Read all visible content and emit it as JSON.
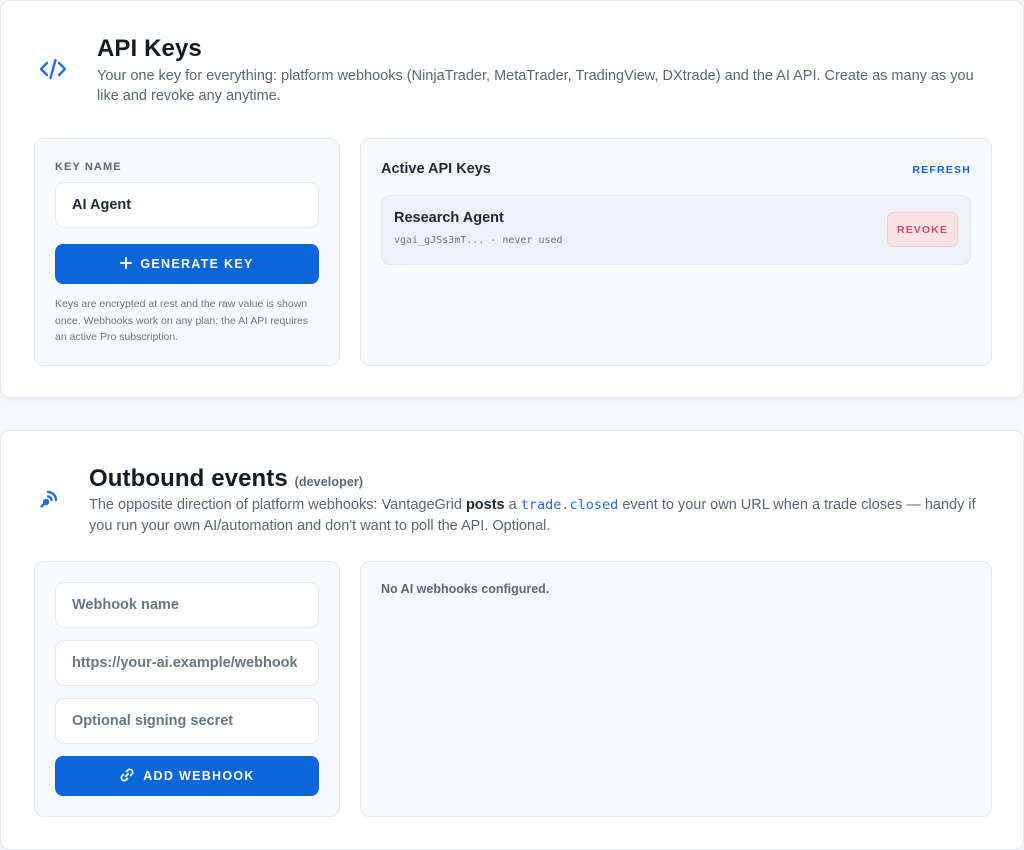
{
  "api_keys": {
    "title": "API Keys",
    "subtitle": "Your one key for everything: platform webhooks (NinjaTrader, MetaTrader, TradingView, DXtrade) and the AI API. Create as many as you like and revoke any anytime.",
    "icon": "code-icon",
    "form": {
      "key_name_label": "KEY NAME",
      "key_name_value": "AI Agent",
      "generate_label": "GENERATE KEY",
      "note": "Keys are encrypted at rest and the raw value is shown once. Webhooks work on any plan; the AI API requires an active Pro subscription."
    },
    "active": {
      "title": "Active API Keys",
      "refresh_label": "REFRESH",
      "keys": [
        {
          "name": "Research Agent",
          "meta": "vgai_gJSs3mT... - never used",
          "revoke_label": "REVOKE"
        }
      ]
    }
  },
  "outbound": {
    "title": "Outbound events",
    "title_tag": "(developer)",
    "icon": "webhook-icon",
    "subtitle_pre": "The opposite direction of platform webhooks: VantageGrid ",
    "subtitle_bold": "posts",
    "subtitle_mid": " a ",
    "subtitle_code": "trade.closed",
    "subtitle_post": " event to your own URL when a trade closes — handy if you run your own AI/automation and don't want to poll the API. Optional.",
    "form": {
      "name_placeholder": "Webhook name",
      "url_placeholder": "https://your-ai.example/webhook",
      "secret_placeholder": "Optional signing secret",
      "add_label": "ADD WEBHOOK"
    },
    "empty_text": "No AI webhooks configured."
  },
  "colors": {
    "accent": "#0a66d9",
    "danger": "#d64b5c"
  }
}
